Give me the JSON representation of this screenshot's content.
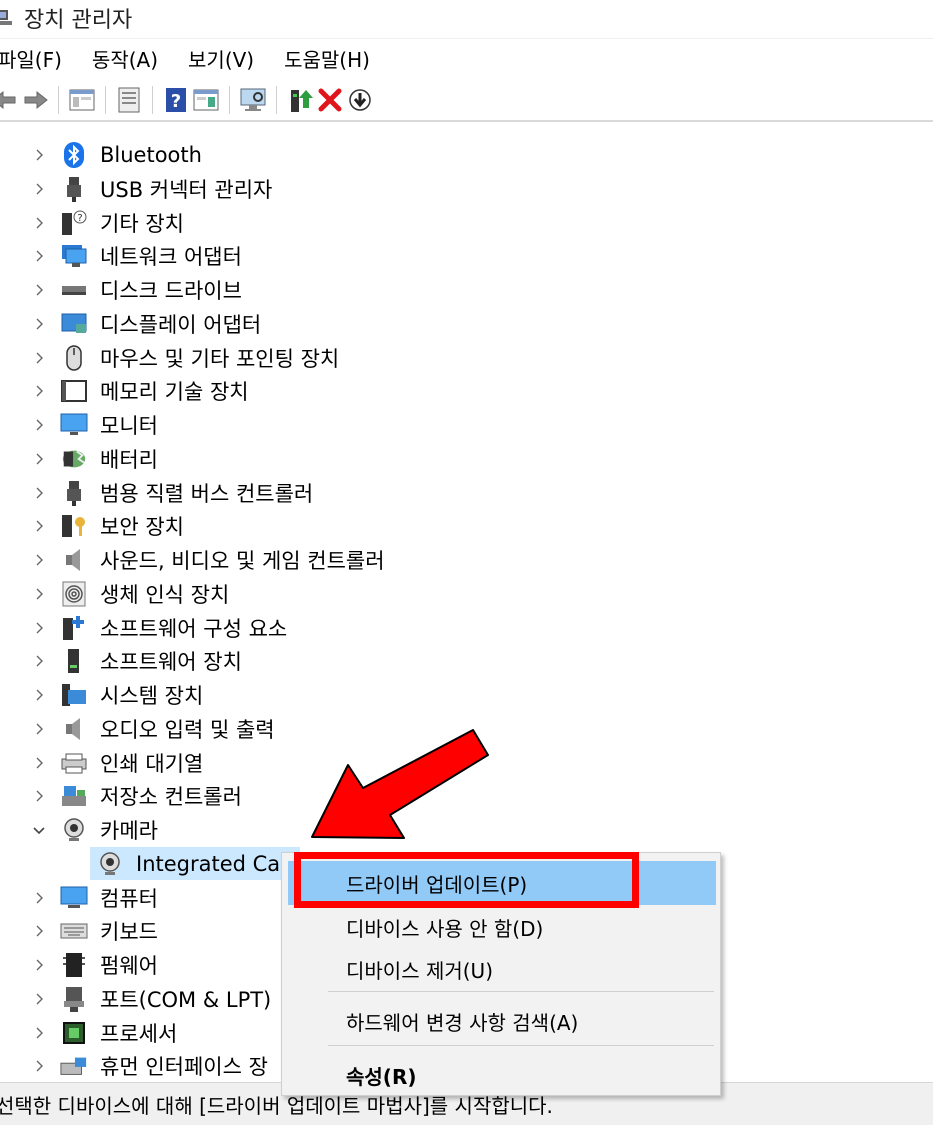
{
  "window": {
    "title": "장치 관리자"
  },
  "menu": [
    "파일(F)",
    "동작(A)",
    "보기(V)",
    "도움말(H)"
  ],
  "tree": {
    "items": [
      {
        "label": "Bluetooth",
        "icon": "bluetooth-icon"
      },
      {
        "label": "USB 커넥터 관리자",
        "icon": "usb-icon"
      },
      {
        "label": "기타 장치",
        "icon": "unknown-device-icon"
      },
      {
        "label": "네트워크 어댑터",
        "icon": "network-adapter-icon"
      },
      {
        "label": "디스크 드라이브",
        "icon": "disk-drive-icon"
      },
      {
        "label": "디스플레이 어댑터",
        "icon": "display-adapter-icon"
      },
      {
        "label": "마우스 및 기타 포인팅 장치",
        "icon": "mouse-icon"
      },
      {
        "label": "메모리 기술 장치",
        "icon": "memory-icon"
      },
      {
        "label": "모니터",
        "icon": "monitor-icon"
      },
      {
        "label": "배터리",
        "icon": "battery-icon"
      },
      {
        "label": "범용 직렬 버스 컨트롤러",
        "icon": "usb-controller-icon"
      },
      {
        "label": "보안 장치",
        "icon": "security-device-icon"
      },
      {
        "label": "사운드, 비디오 및 게임 컨트롤러",
        "icon": "speaker-icon"
      },
      {
        "label": "생체 인식 장치",
        "icon": "fingerprint-icon"
      },
      {
        "label": "소프트웨어 구성 요소",
        "icon": "software-component-icon"
      },
      {
        "label": "소프트웨어 장치",
        "icon": "software-device-icon"
      },
      {
        "label": "시스템 장치",
        "icon": "system-device-icon"
      },
      {
        "label": "오디오 입력 및 출력",
        "icon": "audio-icon"
      },
      {
        "label": "인쇄 대기열",
        "icon": "printer-icon"
      },
      {
        "label": "저장소 컨트롤러",
        "icon": "storage-controller-icon"
      },
      {
        "label": "카메라",
        "icon": "camera-icon"
      },
      {
        "label": "Integrated Can",
        "icon": "webcam-icon"
      },
      {
        "label": "컴퓨터",
        "icon": "computer-icon"
      },
      {
        "label": "키보드",
        "icon": "keyboard-icon"
      },
      {
        "label": "펌웨어",
        "icon": "firmware-icon"
      },
      {
        "label": "포트(COM & LPT)",
        "icon": "port-icon"
      },
      {
        "label": "프로세서",
        "icon": "processor-icon"
      },
      {
        "label": "휴먼 인터페이스 장",
        "icon": "hid-icon"
      }
    ]
  },
  "context_menu": {
    "update_driver": "드라이버 업데이트(P)",
    "disable_device": "디바이스 사용 안 함(D)",
    "uninstall_device": "디바이스 제거(U)",
    "scan_hardware": "하드웨어 변경 사항 검색(A)",
    "properties": "속성(R)"
  },
  "status": {
    "text": "선택한 디바이스에 대해 [드라이버 업데이트 마법사]를 시작합니다."
  },
  "colors": {
    "selection": "#cce8ff",
    "menu_highlight": "#91c9f7",
    "annotation": "#ff0000"
  }
}
